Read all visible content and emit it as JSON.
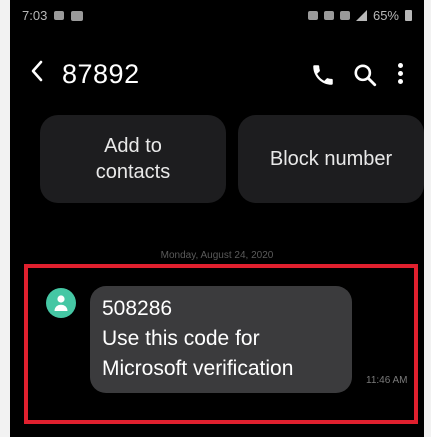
{
  "status_bar": {
    "time": "7:03",
    "battery": "65%"
  },
  "header": {
    "title": "87892",
    "back_icon": "chevron-left",
    "call_icon": "phone-icon",
    "search_icon": "search-icon",
    "more_icon": "more-vertical-icon"
  },
  "actions": {
    "add_line1": "Add to",
    "add_line2": "contacts",
    "block": "Block number"
  },
  "conversation": {
    "date": "Monday, August 24, 2020",
    "message": {
      "line1": "508286",
      "line2": "Use this code for",
      "line3": "Microsoft verification",
      "time": "11:46 AM"
    }
  },
  "colors": {
    "background": "#000000",
    "button_bg": "#1d1d1f",
    "bubble_bg": "#3b3b3d",
    "avatar": "#45c7a4",
    "highlight": "#e0202e"
  }
}
